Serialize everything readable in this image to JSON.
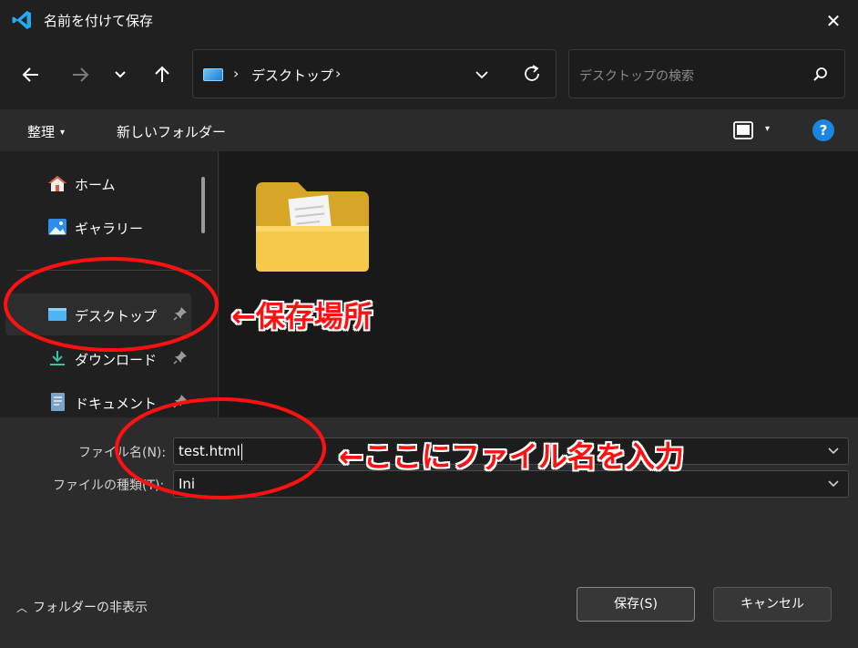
{
  "window": {
    "title": "名前を付けて保存",
    "app_icon": "vscode-icon",
    "close_icon": "close-icon"
  },
  "nav": {
    "back_icon": "arrow-left-icon",
    "forward_icon": "arrow-right-icon",
    "recent_icon": "chevron-down-icon",
    "up_icon": "arrow-up-icon",
    "address": {
      "location_icon": "desktop-icon",
      "crumb": "デスクトップ",
      "separator": "›"
    },
    "search_placeholder": "デスクトップの検索"
  },
  "commandbar": {
    "organize": "整理",
    "new_folder": "新しいフォルダー",
    "help": "?"
  },
  "sidebar": {
    "items": [
      {
        "label": "ホーム",
        "icon": "home-icon"
      },
      {
        "label": "ギャラリー",
        "icon": "gallery-icon"
      },
      {
        "label": "デスクトップ",
        "icon": "desktop-icon",
        "pinned": true,
        "selected": true
      },
      {
        "label": "ダウンロード",
        "icon": "download-icon",
        "pinned": true
      },
      {
        "label": "ドキュメント",
        "icon": "document-icon",
        "pinned": true
      }
    ]
  },
  "content": {
    "items": [
      {
        "type": "folder",
        "icon": "folder-icon"
      }
    ]
  },
  "form": {
    "filename_label": "ファイル名(N):",
    "filename_value": "test.html",
    "filetype_label": "ファイルの種類(T):",
    "filetype_value": "Ini"
  },
  "footer": {
    "hide_folders": "フォルダーの非表示",
    "save": "保存(S)",
    "cancel": "キャンセル"
  },
  "annotations": {
    "location_note": "←保存場所",
    "filename_note": "←ここにファイル名を入力",
    "color": "#ff1111"
  }
}
